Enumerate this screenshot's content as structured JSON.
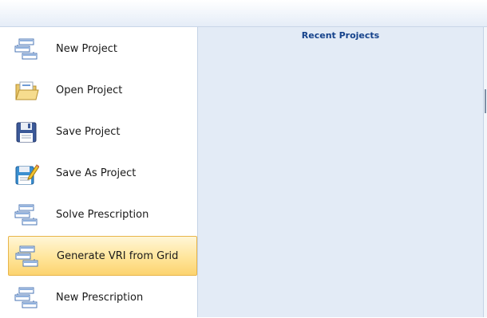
{
  "menu": {
    "items": [
      {
        "label": "New Project",
        "icon": "new-project-icon",
        "active": false
      },
      {
        "label": "Open Project",
        "icon": "folder-open-icon",
        "active": false
      },
      {
        "label": "Save Project",
        "icon": "floppy-disk-icon",
        "active": false
      },
      {
        "label": "Save As Project",
        "icon": "save-as-icon",
        "active": false
      },
      {
        "label": "Solve Prescription",
        "icon": "prescription-icon",
        "active": false
      },
      {
        "label": "Generate VRI from Grid",
        "icon": "grid-icon",
        "active": true
      },
      {
        "label": "New Prescription",
        "icon": "new-prescription-icon",
        "active": false
      }
    ]
  },
  "recent": {
    "title": "Recent Projects"
  },
  "colors": {
    "accent_title": "#15428b",
    "active_highlight": "#ffe59a",
    "pane_background": "#e3ebf6"
  }
}
